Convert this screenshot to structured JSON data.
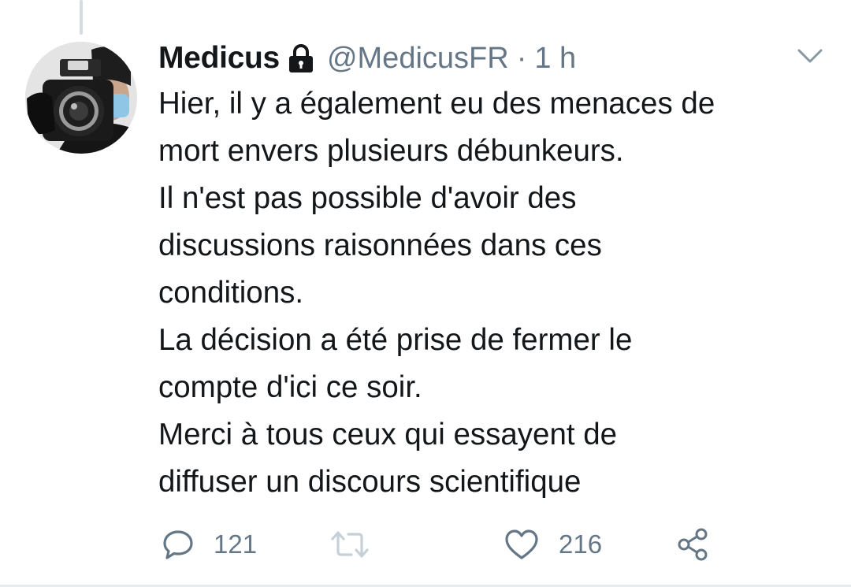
{
  "tweet": {
    "display_name": "Medicus",
    "protected_icon": "lock-icon",
    "handle": "@MedicusFR",
    "separator": "·",
    "time": "1 h",
    "menu_icon": "chevron-down-icon",
    "avatar": "photographer-with-camera-and-mask",
    "body_lines": [
      "Hier, il y a également eu des menaces de",
      "mort envers plusieurs débunkeurs.",
      "Il n'est pas possible d'avoir des",
      "discussions raisonnées dans ces",
      "conditions.",
      "La décision a été prise de fermer le",
      "compte d'ici ce soir.",
      "Merci à tous ceux qui essayent de",
      "diffuser un discours scientifique"
    ]
  },
  "actions": {
    "reply": {
      "icon": "reply-icon",
      "count": "121"
    },
    "retweet": {
      "icon": "retweet-icon",
      "count": ""
    },
    "like": {
      "icon": "heart-icon",
      "count": "216"
    },
    "share": {
      "icon": "share-icon"
    }
  },
  "colors": {
    "text_primary": "#14171a",
    "text_secondary": "#657786",
    "divider": "#e6ecf0",
    "thread_line": "#d4dbe1"
  }
}
